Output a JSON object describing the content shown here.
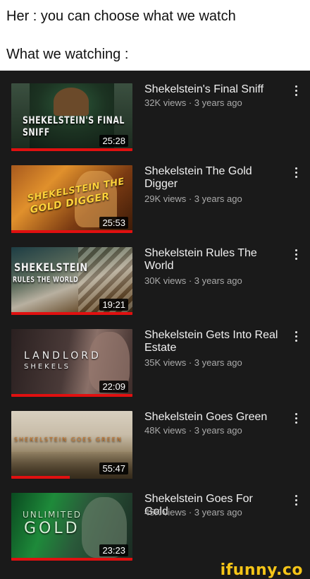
{
  "caption": {
    "line1": "Her : you can choose what we watch",
    "line2": "What we watching :"
  },
  "videos": [
    {
      "title": "Shekelstein's Final Sniff",
      "meta": "32K views · 3 years ago",
      "duration": "25:28",
      "thumb_text": [
        "SHEKELSTEIN'S FINAL SNIFF"
      ],
      "watched_fraction": 1.0
    },
    {
      "title": "Shekelstein The Gold Digger",
      "meta": "29K views · 3 years ago",
      "duration": "25:53",
      "thumb_text": [
        "SHEKELSTEIN THE",
        "GOLD DIGGER"
      ],
      "watched_fraction": 1.0
    },
    {
      "title": "Shekelstein Rules The World",
      "meta": "30K views · 3 years ago",
      "duration": "19:21",
      "thumb_text": [
        "SHEKELSTEIN",
        "RULES THE WORLD"
      ],
      "watched_fraction": 1.0
    },
    {
      "title": "Shekelstein Gets Into Real Estate",
      "meta": "35K views · 3 years ago",
      "duration": "22:09",
      "thumb_text": [
        "LANDLORD",
        "SHEKELS"
      ],
      "watched_fraction": 1.0
    },
    {
      "title": "Shekelstein Goes Green",
      "meta": "48K views · 3 years ago",
      "duration": "55:47",
      "thumb_text": [
        "SHEKELSTEIN GOES GREEN"
      ],
      "watched_fraction": 0.48
    },
    {
      "title": "Shekelstein Goes For Gold",
      "meta": "45K views · 3 years ago",
      "duration": "23:23",
      "thumb_text": [
        "UNLIMITED",
        "GOLD"
      ],
      "watched_fraction": 1.0
    }
  ],
  "watermark": "ifunny.co",
  "colors": {
    "app_background": "#1a1a1a",
    "progress": "#e01010",
    "title_text": "#f1f1f1",
    "meta_text": "#aaaaaa",
    "watermark": "#f5c518"
  },
  "icons": {
    "menu": "more-vert-icon"
  }
}
